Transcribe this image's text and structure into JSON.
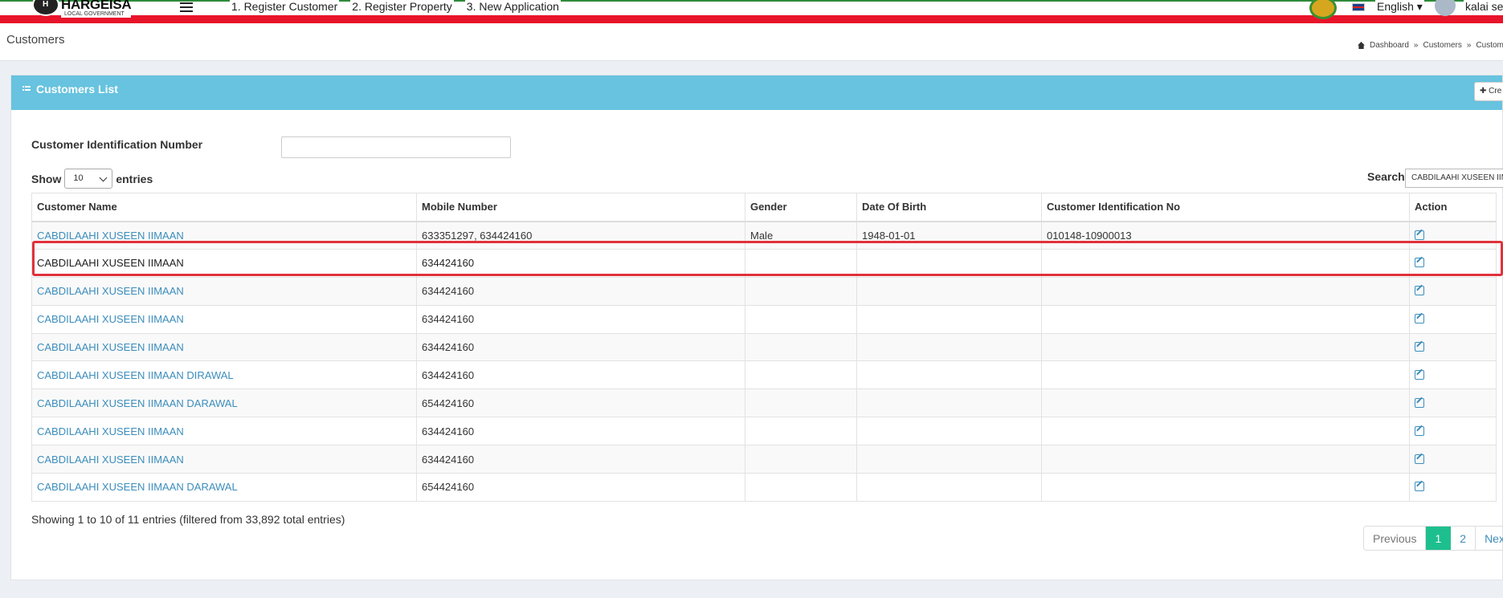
{
  "header": {
    "logo_title": "HARGEISA",
    "logo_subtitle": "LOCAL GOVERNMENT",
    "nav": [
      "1. Register Customer",
      "2. Register Property",
      "3. New Application"
    ],
    "language": "English",
    "user": "kalai sel"
  },
  "content_header": {
    "title": "Customers",
    "breadcrumb": [
      "Dashboard",
      "Customers",
      "Custom"
    ]
  },
  "box": {
    "title": "Customers List",
    "create_label": "Cre",
    "filter_label": "Customer Identification Number",
    "filter_value": "",
    "show_label": "Show",
    "entries_label": "entries",
    "page_size": "10",
    "search_label": "Search:",
    "search_value": "CABDILAAHI XUSEEN IIM"
  },
  "table": {
    "columns": [
      "Customer Name",
      "Mobile Number",
      "Gender",
      "Date Of Birth",
      "Customer Identification No",
      "Action"
    ],
    "rows": [
      {
        "name": "CABDILAAHI XUSEEN IIMAAN",
        "mobile": "633351297, 634424160",
        "gender": "Male",
        "dob": "1948-01-01",
        "cid": "010148-10900013"
      },
      {
        "name": "CABDILAAHI XUSEEN IIMAAN",
        "mobile": "634424160",
        "gender": "",
        "dob": "",
        "cid": ""
      },
      {
        "name": "CABDILAAHI XUSEEN IIMAAN",
        "mobile": "634424160",
        "gender": "",
        "dob": "",
        "cid": ""
      },
      {
        "name": "CABDILAAHI XUSEEN IIMAAN",
        "mobile": "634424160",
        "gender": "",
        "dob": "",
        "cid": ""
      },
      {
        "name": "CABDILAAHI XUSEEN IIMAAN",
        "mobile": "634424160",
        "gender": "",
        "dob": "",
        "cid": ""
      },
      {
        "name": "CABDILAAHI XUSEEN IIMAAN DIRAWAL",
        "mobile": "634424160",
        "gender": "",
        "dob": "",
        "cid": ""
      },
      {
        "name": "CABDILAAHI XUSEEN IIMAAN DARAWAL",
        "mobile": "654424160",
        "gender": "",
        "dob": "",
        "cid": ""
      },
      {
        "name": "CABDILAAHI XUSEEN IIMAAN",
        "mobile": "634424160",
        "gender": "",
        "dob": "",
        "cid": ""
      },
      {
        "name": "CABDILAAHI XUSEEN IIMAAN",
        "mobile": "634424160",
        "gender": "",
        "dob": "",
        "cid": ""
      },
      {
        "name": "CABDILAAHI XUSEEN IIMAAN DARAWAL",
        "mobile": "654424160",
        "gender": "",
        "dob": "",
        "cid": ""
      }
    ]
  },
  "footer": {
    "info": "Showing 1 to 10 of 11 entries (filtered from 33,892 total entries)",
    "pagination": {
      "previous": "Previous",
      "pages": [
        "1",
        "2"
      ],
      "active": "1",
      "next": "Next"
    }
  },
  "colors": {
    "accent": "#67c3df",
    "link": "#3c8dbc",
    "active_page": "#1ebf8e",
    "header_stripe": "#e8142a",
    "highlight": "#e0313b"
  }
}
